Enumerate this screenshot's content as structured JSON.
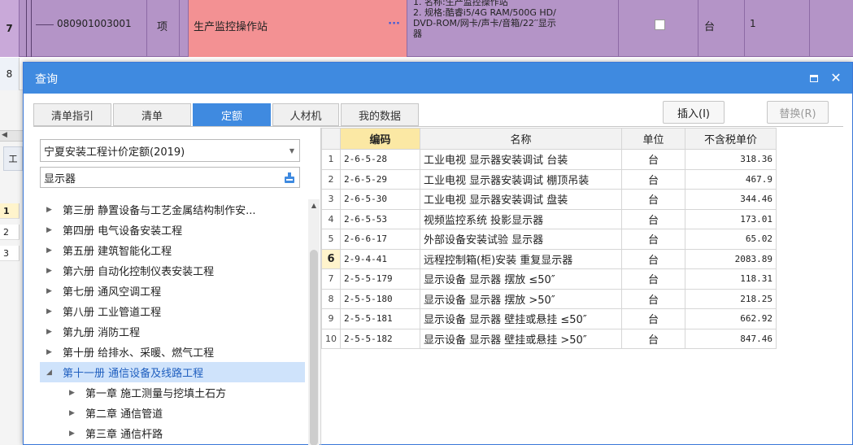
{
  "background": {
    "row7": {
      "row_number": "7",
      "code": "080901003001",
      "unit": "项",
      "name": "生产监控操作站",
      "name_more": "···",
      "description_lines": [
        "1. 名称:生产监控操作站",
        "2. 规格:酷睿i5/4G RAM/500G HD/",
        "DVD-ROM/网卡/声卡/音箱/22′′显示",
        "器"
      ],
      "unit2": "台",
      "qty": "1"
    },
    "row8_number": "8",
    "tab_label": "工",
    "rows": [
      {
        "n": "1"
      },
      {
        "n": "2"
      },
      {
        "n": "3"
      }
    ]
  },
  "dialog": {
    "title": "查询",
    "tabs": [
      {
        "label": "清单指引",
        "active": false
      },
      {
        "label": "清单",
        "active": false
      },
      {
        "label": "定额",
        "active": true
      },
      {
        "label": "人材机",
        "active": false
      },
      {
        "label": "我的数据",
        "active": false
      }
    ],
    "insert_label": "插入(I)",
    "replace_label": "替换(R)",
    "library": "宁夏安装工程计价定额(2019)",
    "search_value": "显示器",
    "tree": [
      {
        "label": "第三册 静置设备与工艺金属结构制作安...",
        "level": 1,
        "expanded": false,
        "selected": false
      },
      {
        "label": "第四册 电气设备安装工程",
        "level": 1,
        "expanded": false,
        "selected": false
      },
      {
        "label": "第五册 建筑智能化工程",
        "level": 1,
        "expanded": false,
        "selected": false
      },
      {
        "label": "第六册 自动化控制仪表安装工程",
        "level": 1,
        "expanded": false,
        "selected": false
      },
      {
        "label": "第七册 通风空调工程",
        "level": 1,
        "expanded": false,
        "selected": false
      },
      {
        "label": "第八册 工业管道工程",
        "level": 1,
        "expanded": false,
        "selected": false
      },
      {
        "label": "第九册 消防工程",
        "level": 1,
        "expanded": false,
        "selected": false
      },
      {
        "label": "第十册 给排水、采暖、燃气工程",
        "level": 1,
        "expanded": false,
        "selected": false
      },
      {
        "label": "第十一册 通信设备及线路工程",
        "level": 1,
        "expanded": true,
        "selected": true
      },
      {
        "label": "第一章 施工测量与挖填土石方",
        "level": 2,
        "expanded": false,
        "selected": false
      },
      {
        "label": "第二章 通信管道",
        "level": 2,
        "expanded": false,
        "selected": false
      },
      {
        "label": "第三章 通信杆路",
        "level": 2,
        "expanded": false,
        "selected": false
      }
    ],
    "grid": {
      "headers": [
        "编码",
        "名称",
        "单位",
        "不含税单价"
      ],
      "rows": [
        {
          "n": "1",
          "code": "2-6-5-28",
          "name": "工业电视 显示器安装调试 台装",
          "unit": "台",
          "price": "318.36"
        },
        {
          "n": "2",
          "code": "2-6-5-29",
          "name": "工业电视 显示器安装调试 棚顶吊装",
          "unit": "台",
          "price": "467.9"
        },
        {
          "n": "3",
          "code": "2-6-5-30",
          "name": "工业电视 显示器安装调试 盘装",
          "unit": "台",
          "price": "344.46"
        },
        {
          "n": "4",
          "code": "2-6-5-53",
          "name": "视频监控系统 投影显示器",
          "unit": "台",
          "price": "173.01"
        },
        {
          "n": "5",
          "code": "2-6-6-17",
          "name": "外部设备安装试验 显示器",
          "unit": "台",
          "price": "65.02"
        },
        {
          "n": "6",
          "code": "2-9-4-41",
          "name": "远程控制箱(柜)安装 重复显示器",
          "unit": "台",
          "price": "2083.89",
          "highlight": true
        },
        {
          "n": "7",
          "code": "2-5-5-179",
          "name": "显示设备 显示器 摆放 ≤50″",
          "unit": "台",
          "price": "118.31"
        },
        {
          "n": "8",
          "code": "2-5-5-180",
          "name": "显示设备 显示器 摆放 >50″",
          "unit": "台",
          "price": "218.25"
        },
        {
          "n": "9",
          "code": "2-5-5-181",
          "name": "显示设备 显示器 壁挂或悬挂 ≤50″",
          "unit": "台",
          "price": "662.92"
        },
        {
          "n": "10",
          "code": "2-5-5-182",
          "name": "显示设备 显示器 壁挂或悬挂 >50″",
          "unit": "台",
          "price": "847.46"
        }
      ]
    }
  },
  "colors": {
    "accent": "#3f8ae0",
    "row_purple": "#b494c7",
    "name_cell_red": "#f39193",
    "header_yellow": "#fbe8a4",
    "tree_selected": "#cfe3fb"
  }
}
